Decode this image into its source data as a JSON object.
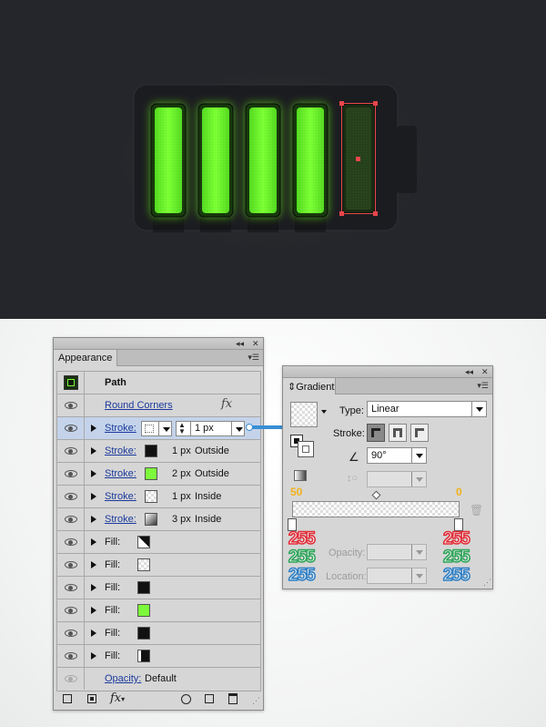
{
  "artwork": {
    "colors": {
      "background": "#25262b",
      "body": "#1d1e22",
      "glow": "#7dff2a",
      "cell": "#59f01c",
      "empty_cell": "#1f3318",
      "selection": "#e8464b"
    },
    "filled_cells": 4,
    "empty_cells": 1
  },
  "appearance": {
    "tab": "Appearance",
    "topbar_collapse": "◂◂",
    "topbar_close": "✕",
    "path_label": "Path",
    "round_corners": "Round Corners",
    "fx": "fx",
    "selected_stroke": {
      "label": "Stroke:",
      "weight": "1 px"
    },
    "strokes": [
      {
        "label": "Stroke:",
        "weight": "1 px",
        "position": "Outside",
        "swatch": "#111111"
      },
      {
        "label": "Stroke:",
        "weight": "2 px",
        "position": "Outside",
        "swatch": "#7cf93a"
      },
      {
        "label": "Stroke:",
        "weight": "1 px",
        "position": "Inside",
        "swatch": "checker"
      },
      {
        "label": "Stroke:",
        "weight": "3 px",
        "position": "Inside",
        "swatch": "gradient"
      }
    ],
    "fills": [
      {
        "label": "Fill:",
        "swatch": "pattern"
      },
      {
        "label": "Fill:",
        "swatch": "checker"
      },
      {
        "label": "Fill:",
        "swatch": "#111111"
      },
      {
        "label": "Fill:",
        "swatch": "#7cf93a"
      },
      {
        "label": "Fill:",
        "swatch": "#111111"
      },
      {
        "label": "Fill:",
        "swatch": "half"
      }
    ],
    "opacity_label": "Opacity:",
    "opacity_value": "Default",
    "bottom_icons": [
      "new-stroke-icon",
      "new-fill-icon",
      "fx-menu-icon",
      "clear-icon",
      "duplicate-icon",
      "trash-icon"
    ]
  },
  "gradient": {
    "tab": "Gradient",
    "tab_arrows": "⇕",
    "type_label": "Type:",
    "type_value": "Linear",
    "stroke_label": "Stroke:",
    "angle_value": "90°",
    "left_location": "50",
    "right_location": "0",
    "opacity_label": "Opacity:",
    "location_label": "Location:",
    "left_rgb": [
      "255",
      "255",
      "255"
    ],
    "right_rgb": [
      "255",
      "255",
      "255"
    ]
  }
}
